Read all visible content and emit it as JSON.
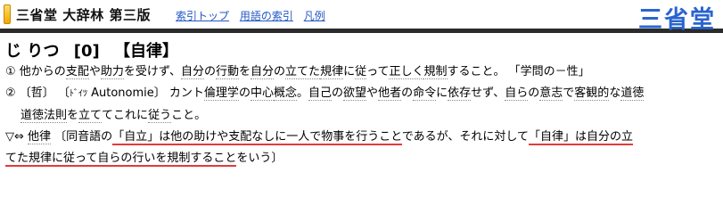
{
  "header": {
    "title": "三省堂 大辞林 第三版",
    "nav": [
      "索引トップ",
      "用語の索引",
      "凡例"
    ],
    "brand": "三省堂"
  },
  "entry": {
    "reading": "じ りつ",
    "accent": "[0]",
    "kanji": "【自律】"
  },
  "senses": {
    "s1": {
      "num": "①",
      "p1": "他からの",
      "t1": "支配",
      "p2": "や",
      "t2": "助力",
      "p3": "を受けず、",
      "t3": "自分",
      "p4": "の",
      "t4": "行動",
      "p5": "を",
      "t5": "自分",
      "p6": "の",
      "t6": "立てた",
      "p7": "",
      "t7": "規律",
      "p8": "に",
      "t8": "従",
      "p9": "って",
      "t9": "正しく",
      "p10": "",
      "t10": "規制",
      "p11": "すること。 「学問の－性」"
    },
    "s2": {
      "num": "②",
      "field": "〔哲〕",
      "lang_open": "〔",
      "lang": "ﾄﾞｲﾂ",
      "word": "Autonomie",
      "lang_close": "〕",
      "p1": " カント",
      "t1": "倫理学",
      "p2": "の",
      "t2": "中心",
      "p3": "",
      "t3": "概念",
      "p4": "。",
      "t4": "自己",
      "p5": "の",
      "t5": "欲望",
      "p6": "や",
      "t6": "他者",
      "p7": "の",
      "t7": "命令",
      "p8": "に",
      "t8": "依存",
      "p9": "せず、",
      "t9": "自ら",
      "p10": "の",
      "t10": "意志",
      "p11": "で",
      "t11": "客観的",
      "p12": "な",
      "t12": "道徳",
      "p13": "",
      "c1": "",
      "ct1": "道徳法則",
      "c2": "を",
      "ct2": "立て",
      "c3": "てこれに",
      "ct3": "従う",
      "c4": "こと。"
    },
    "note": {
      "mark": "▽⇔",
      "ant": "他律",
      "pre": " 〔同音語の",
      "h1": "「自立」は他の助けや支配なしに一人で物事を行うこと",
      "mid": "であるが、それに対して",
      "h2": "「自律」は自分の立",
      "h3": "てた規律に従って自らの行いを規制すること",
      "post": "をいう〕"
    }
  }
}
